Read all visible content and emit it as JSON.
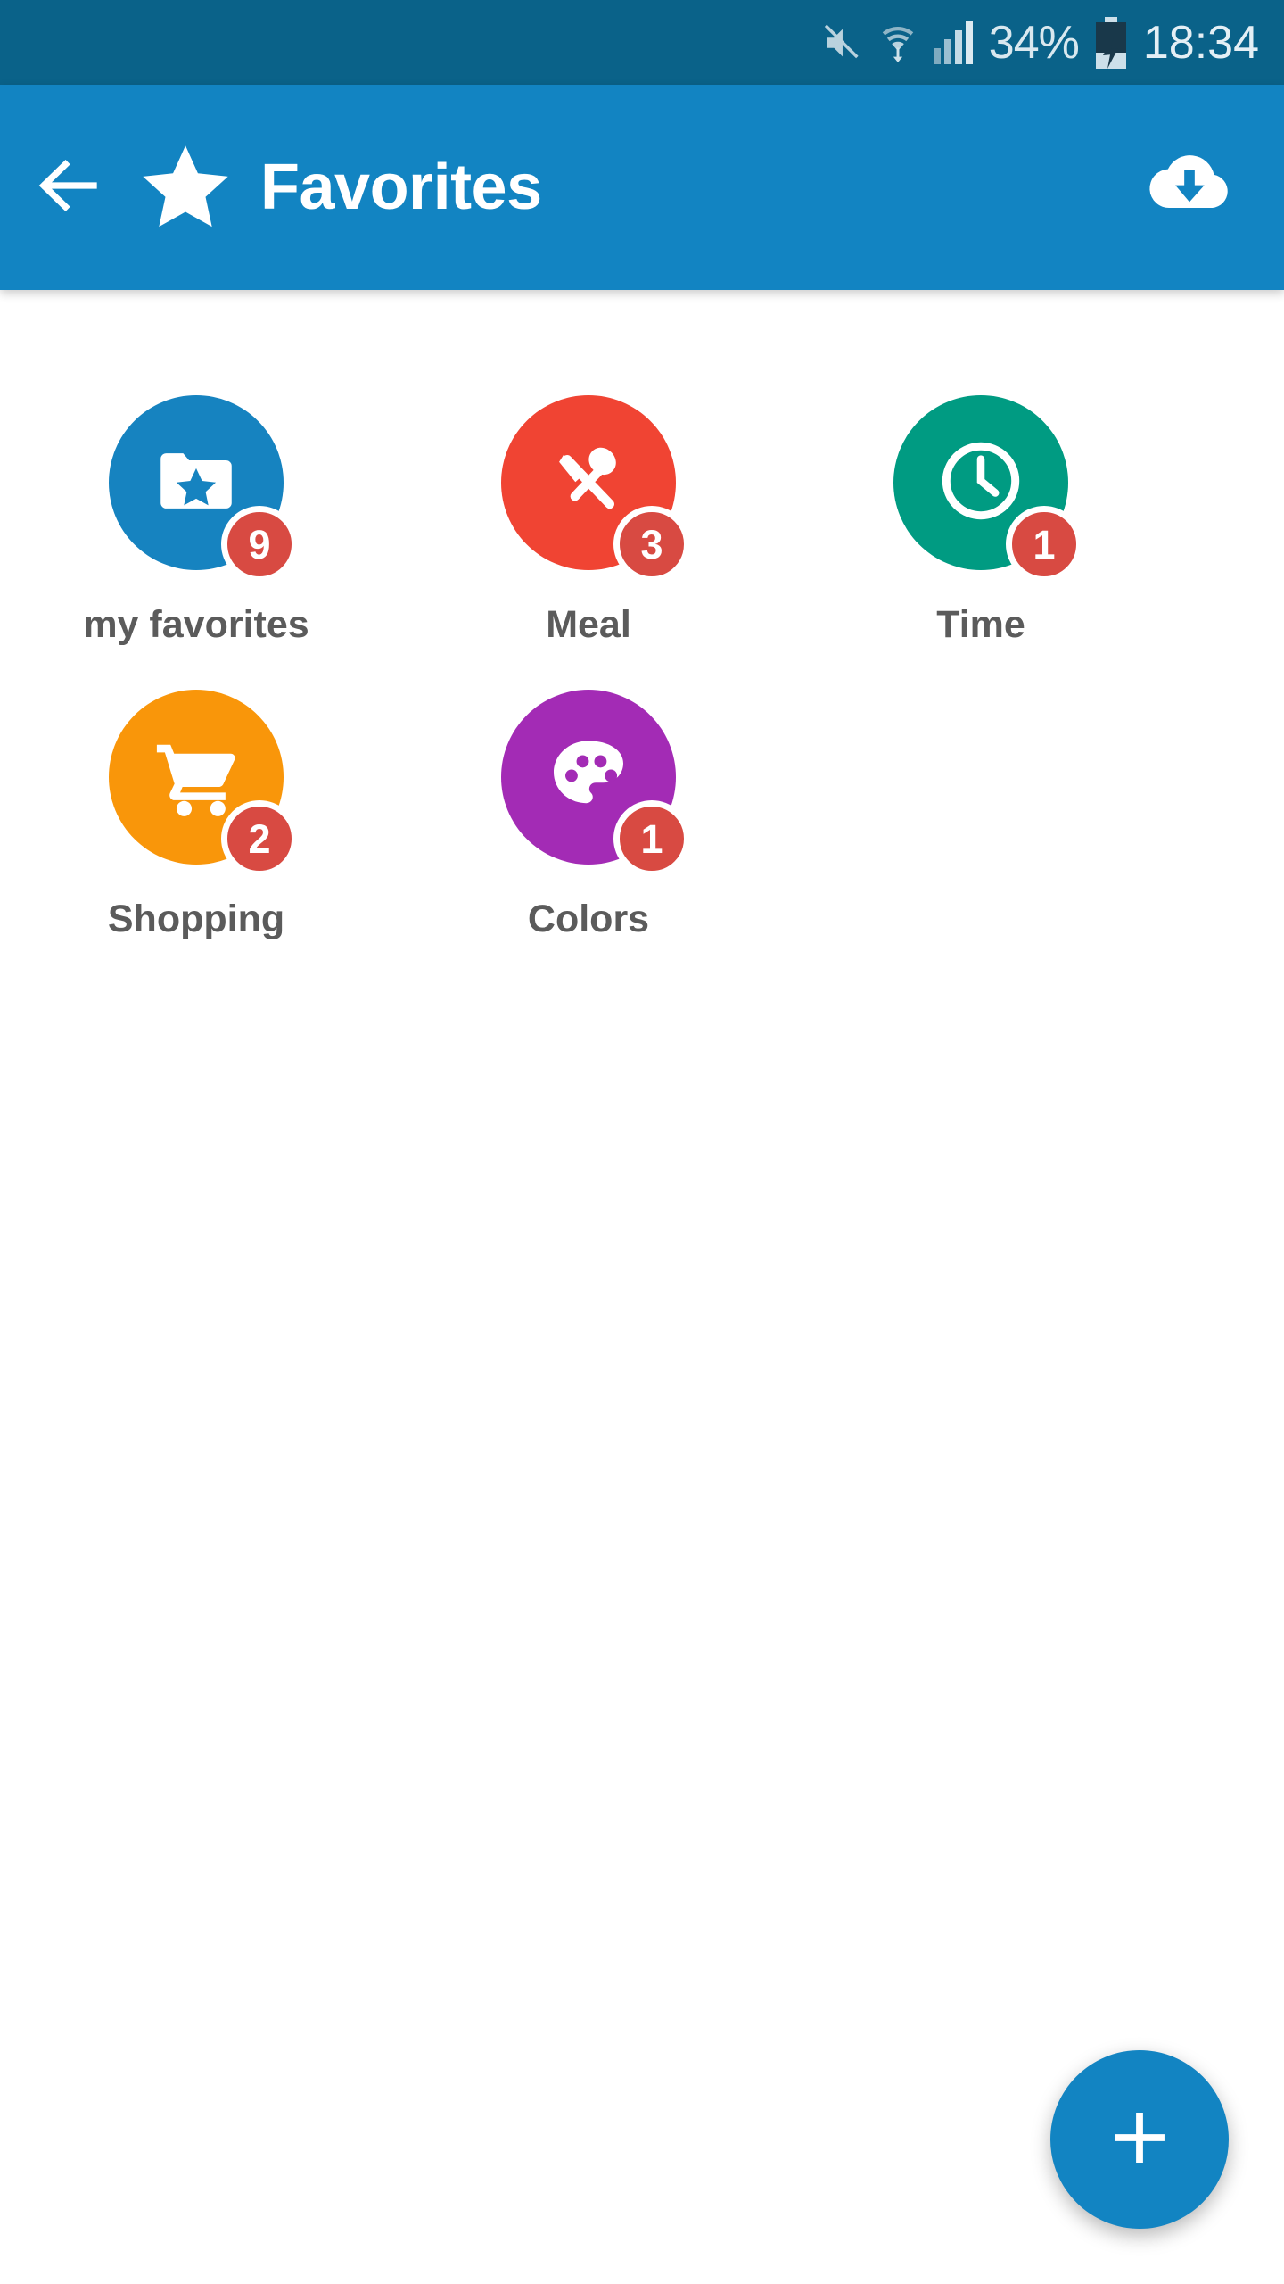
{
  "status_bar": {
    "background": "#0A6289",
    "mute_icon": "mute-icon",
    "wifi_icon": "wifi-download-icon",
    "signal_icon": "cellular-signal-icon",
    "battery_percent": "34%",
    "battery_icon": "battery-charging-icon",
    "time": "18:34"
  },
  "app_bar": {
    "background": "#1284C2",
    "back_icon": "back-arrow-icon",
    "star_icon": "star-icon",
    "title": "Favorites",
    "download_icon": "cloud-download-icon"
  },
  "categories": [
    {
      "label": "my favorites",
      "count": "9",
      "color": "#1683C0",
      "icon": "folder-star-icon"
    },
    {
      "label": "Meal",
      "count": "3",
      "color": "#F04433",
      "icon": "cutlery-icon"
    },
    {
      "label": "Time",
      "count": "1",
      "color": "#009B82",
      "icon": "clock-icon"
    },
    {
      "label": "Shopping",
      "count": "2",
      "color": "#F9960A",
      "icon": "shopping-cart-icon"
    },
    {
      "label": "Colors",
      "count": "1",
      "color": "#A32BB5",
      "icon": "palette-icon"
    }
  ],
  "fab": {
    "icon": "plus-icon",
    "color": "#1284C2"
  },
  "colors": {
    "badge_red": "#D84A42",
    "label_gray": "#5B5B5B",
    "status_bar_blue": "#0A6289",
    "app_bar_blue": "#1284C2"
  }
}
